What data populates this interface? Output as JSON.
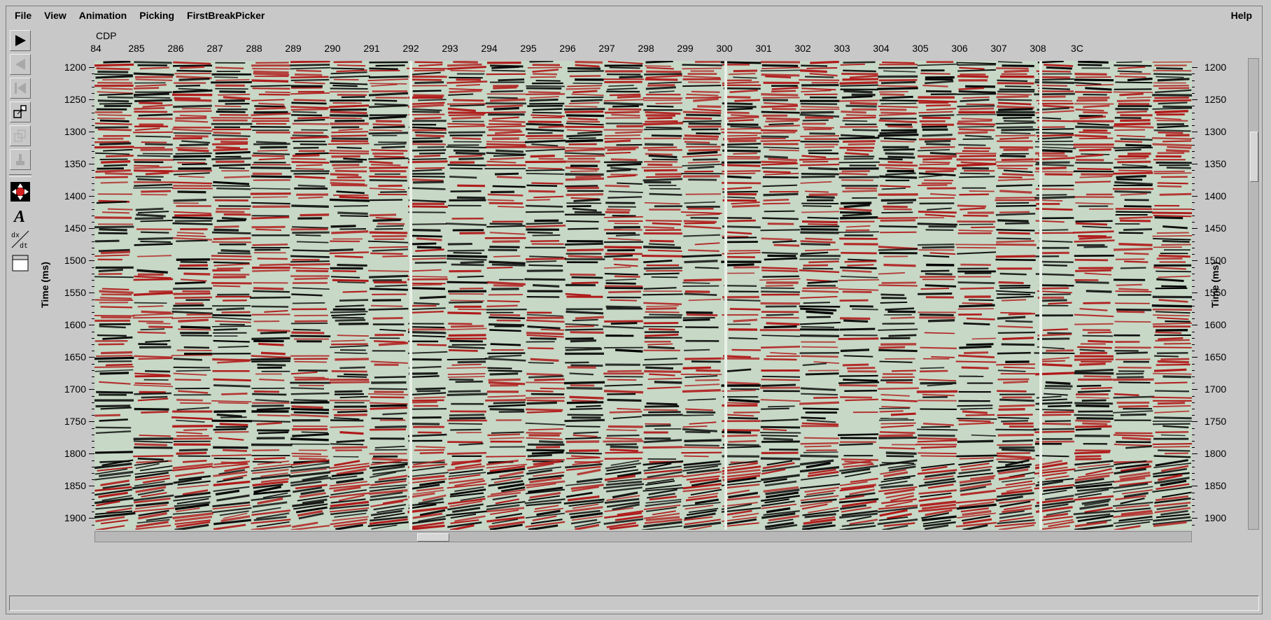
{
  "menubar": {
    "items": [
      "File",
      "View",
      "Animation",
      "Picking",
      "FirstBreakPicker"
    ],
    "help": "Help"
  },
  "toolbar": {
    "icons": [
      "play-icon",
      "step-back-icon",
      "rewind-icon",
      "zoom-window-icon",
      "zoom-disabled-icon",
      "paint-disabled-icon",
      "pan-arrows-icon",
      "annotate-text-icon",
      "velocity-dxdt-icon",
      "max-window-icon"
    ]
  },
  "plot": {
    "x_axis_label": "CDP",
    "x_ticks": [
      "84",
      "285",
      "286",
      "287",
      "288",
      "289",
      "290",
      "291",
      "292",
      "293",
      "294",
      "295",
      "296",
      "297",
      "298",
      "299",
      "300",
      "301",
      "302",
      "303",
      "304",
      "305",
      "306",
      "307",
      "308",
      "3C"
    ],
    "y_axis_label": "Time (ms)",
    "y_ticks": [
      "1200",
      "1250",
      "1300",
      "1350",
      "1400",
      "1450",
      "1500",
      "1550",
      "1600",
      "1650",
      "1700",
      "1750",
      "1800",
      "1850",
      "1900"
    ],
    "y_range_ms": [
      1190,
      1918
    ],
    "colors": {
      "positive": "#b01818",
      "negative": "#000000",
      "background": "#c7d8c6"
    }
  },
  "statusbar": {
    "text": ""
  }
}
